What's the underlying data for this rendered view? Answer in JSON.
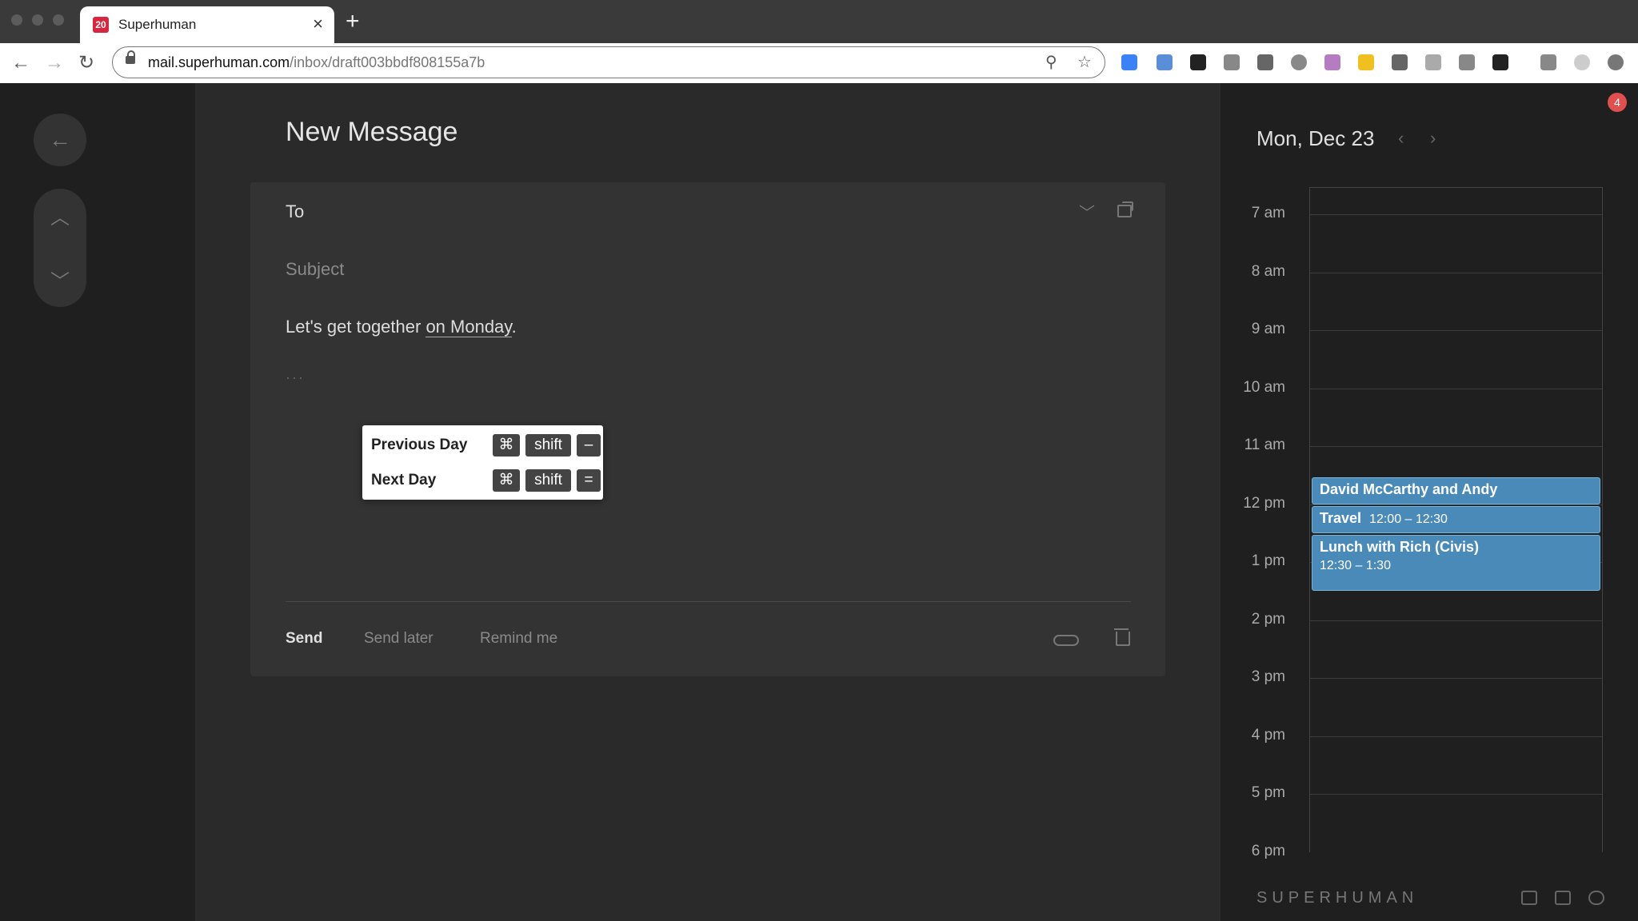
{
  "browser": {
    "tab_title": "Superhuman",
    "tab_favicon": "20",
    "url_host": "mail.superhuman.com",
    "url_path": "/inbox/draft003bbdf808155a7b"
  },
  "compose": {
    "page_title": "New Message",
    "to_label": "To",
    "subject_placeholder": "Subject",
    "body_prefix": "Let's get together ",
    "body_link": "on Monday",
    "body_suffix": ".",
    "ellipsis": "···",
    "send_label": "Send",
    "send_later_label": "Send later",
    "remind_label": "Remind me"
  },
  "shortcut_popup": {
    "rows": [
      {
        "label": "Previous Day",
        "keys": [
          "⌘",
          "shift",
          "–"
        ]
      },
      {
        "label": "Next Day",
        "keys": [
          "⌘",
          "shift",
          "="
        ]
      }
    ]
  },
  "calendar": {
    "date": "Mon, Dec 23",
    "hours": [
      "7 am",
      "8 am",
      "9 am",
      "10 am",
      "11 am",
      "12 pm",
      "1 pm",
      "2 pm",
      "3 pm",
      "4 pm",
      "5 pm",
      "6 pm"
    ],
    "events": [
      {
        "title": "David McCarthy and Andy",
        "time": ""
      },
      {
        "title": "Travel",
        "time": "12:00 – 12:30"
      },
      {
        "title": "Lunch with Rich (Civis)",
        "time": "12:30 – 1:30"
      }
    ],
    "event_color": "#4a8ab8"
  },
  "notification_count": "4",
  "brand": "SUPERHUMAN"
}
